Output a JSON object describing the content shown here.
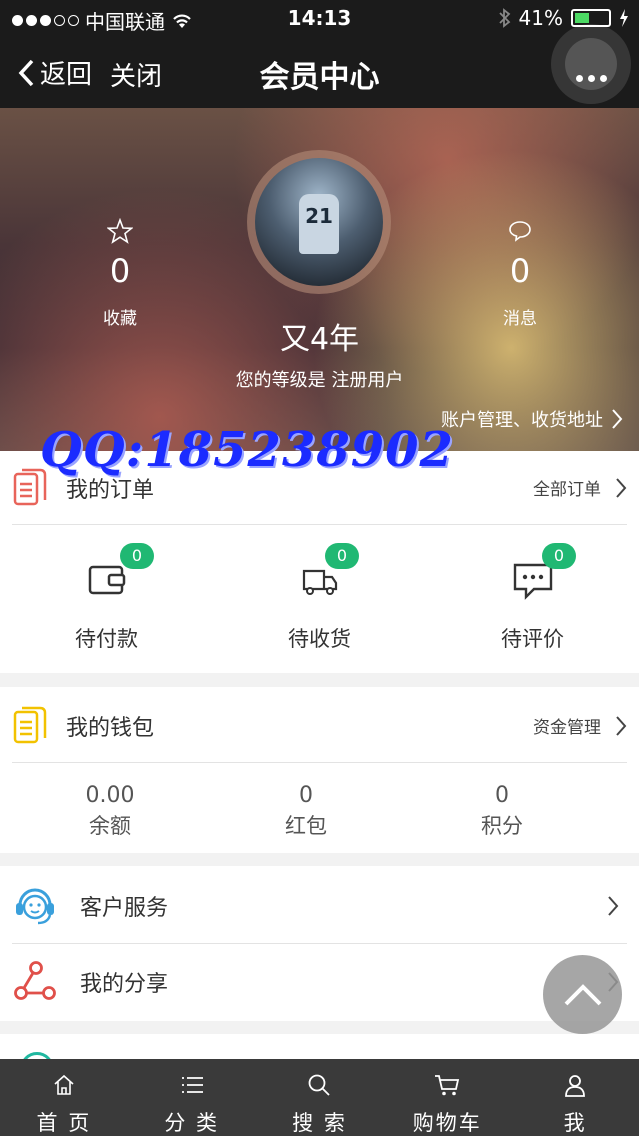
{
  "status": {
    "carrier": "中国联通",
    "time": "14:13",
    "battery": "41%"
  },
  "nav": {
    "back": "返回",
    "close": "关闭",
    "title": "会员中心"
  },
  "profile": {
    "favorites_count": "0",
    "favorites_label": "收藏",
    "messages_count": "0",
    "messages_label": "消息",
    "username": "又4年",
    "level_text": "您的等级是 注册用户",
    "account_link": "账户管理、收货地址",
    "jersey_number": "21"
  },
  "watermark": "QQ:185238902",
  "orders": {
    "title": "我的订单",
    "all_link": "全部订单",
    "items": [
      {
        "label": "待付款",
        "count": "0"
      },
      {
        "label": "待收货",
        "count": "0"
      },
      {
        "label": "待评价",
        "count": "0"
      }
    ]
  },
  "wallet": {
    "title": "我的钱包",
    "manage_link": "资金管理",
    "items": [
      {
        "value": "0.00",
        "label": "余额"
      },
      {
        "value": "0",
        "label": "红包"
      },
      {
        "value": "0",
        "label": "积分"
      }
    ]
  },
  "services": [
    {
      "label": "客户服务"
    },
    {
      "label": "我的分享"
    }
  ],
  "tabs": [
    {
      "label": "首 页",
      "icon": "home-icon"
    },
    {
      "label": "分 类",
      "icon": "list-icon"
    },
    {
      "label": "搜 索",
      "icon": "search-icon"
    },
    {
      "label": "购物车",
      "icon": "cart-icon"
    },
    {
      "label": "我",
      "icon": "user-icon"
    }
  ],
  "colors": {
    "accent_green": "#20b873",
    "order_icon": "#e8645a",
    "wallet_icon": "#f2c200",
    "service_icon": "#3aa0dc",
    "share_icon": "#e0504a"
  }
}
